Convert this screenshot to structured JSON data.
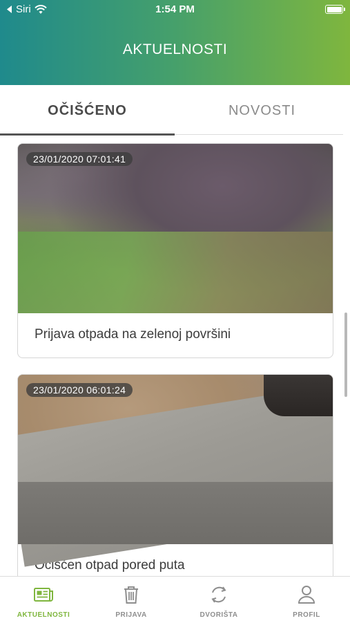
{
  "status_bar": {
    "back_label": "Siri",
    "time": "1:54 PM"
  },
  "header": {
    "title": "AKTUELNOSTI"
  },
  "tabs": [
    {
      "label": "OČIŠĆENO",
      "active": true
    },
    {
      "label": "NOVOSTI",
      "active": false
    }
  ],
  "feed": [
    {
      "timestamp": "23/01/2020 07:01:41",
      "caption": "Prijava otpada na zelenoj površini"
    },
    {
      "timestamp": "23/01/2020 06:01:24",
      "caption": "Očišćen otpad pored puta"
    }
  ],
  "tabbar": [
    {
      "label": "AKTUELNOSTI",
      "icon": "newspaper-icon",
      "active": true
    },
    {
      "label": "PRIJAVA",
      "icon": "trash-icon",
      "active": false
    },
    {
      "label": "DVORIŠTA",
      "icon": "refresh-cycle-icon",
      "active": false
    },
    {
      "label": "PROFIL",
      "icon": "person-icon",
      "active": false
    }
  ],
  "colors": {
    "accent": "#7fb63e",
    "header_start": "#1f8a8c",
    "header_end": "#7fb63e"
  }
}
